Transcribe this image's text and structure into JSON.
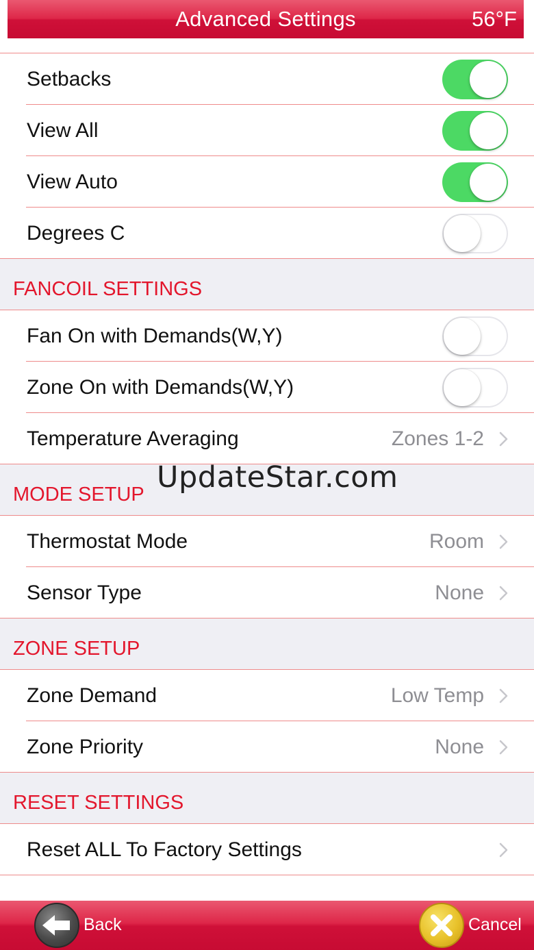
{
  "header": {
    "title": "Advanced Settings",
    "temperature": "56°F"
  },
  "toggles": [
    {
      "label": "Setbacks",
      "state": "on"
    },
    {
      "label": "View All",
      "state": "on"
    },
    {
      "label": "View Auto",
      "state": "on"
    },
    {
      "label": "Degrees C",
      "state": "off"
    }
  ],
  "fancoil": {
    "title": "FANCOIL SETTINGS",
    "fan_on_label": "Fan On with Demands(W,Y)",
    "fan_on_state": "off",
    "zone_on_label": "Zone On with Demands(W,Y)",
    "zone_on_state": "off",
    "temp_avg_label": "Temperature Averaging",
    "temp_avg_value": "Zones 1-2"
  },
  "mode_setup": {
    "title": "MODE SETUP",
    "thermostat_mode_label": "Thermostat Mode",
    "thermostat_mode_value": "Room",
    "sensor_type_label": "Sensor Type",
    "sensor_type_value": "None"
  },
  "zone_setup": {
    "title": "ZONE SETUP",
    "zone_demand_label": "Zone Demand",
    "zone_demand_value": "Low Temp",
    "zone_priority_label": "Zone Priority",
    "zone_priority_value": "None"
  },
  "reset": {
    "title": "RESET SETTINGS",
    "reset_all_label": "Reset ALL To Factory Settings"
  },
  "watermark": "UpdateStar.com",
  "footer": {
    "back_label": "Back",
    "cancel_label": "Cancel",
    "back_icon": "back-arrow-icon",
    "cancel_icon": "x-icon"
  },
  "colors": {
    "accent": "#d5153d",
    "toggle_on": "#4cd964",
    "section_text": "#e3162c",
    "separator": "#ee8a8a",
    "value_gray": "#8e8e93"
  }
}
